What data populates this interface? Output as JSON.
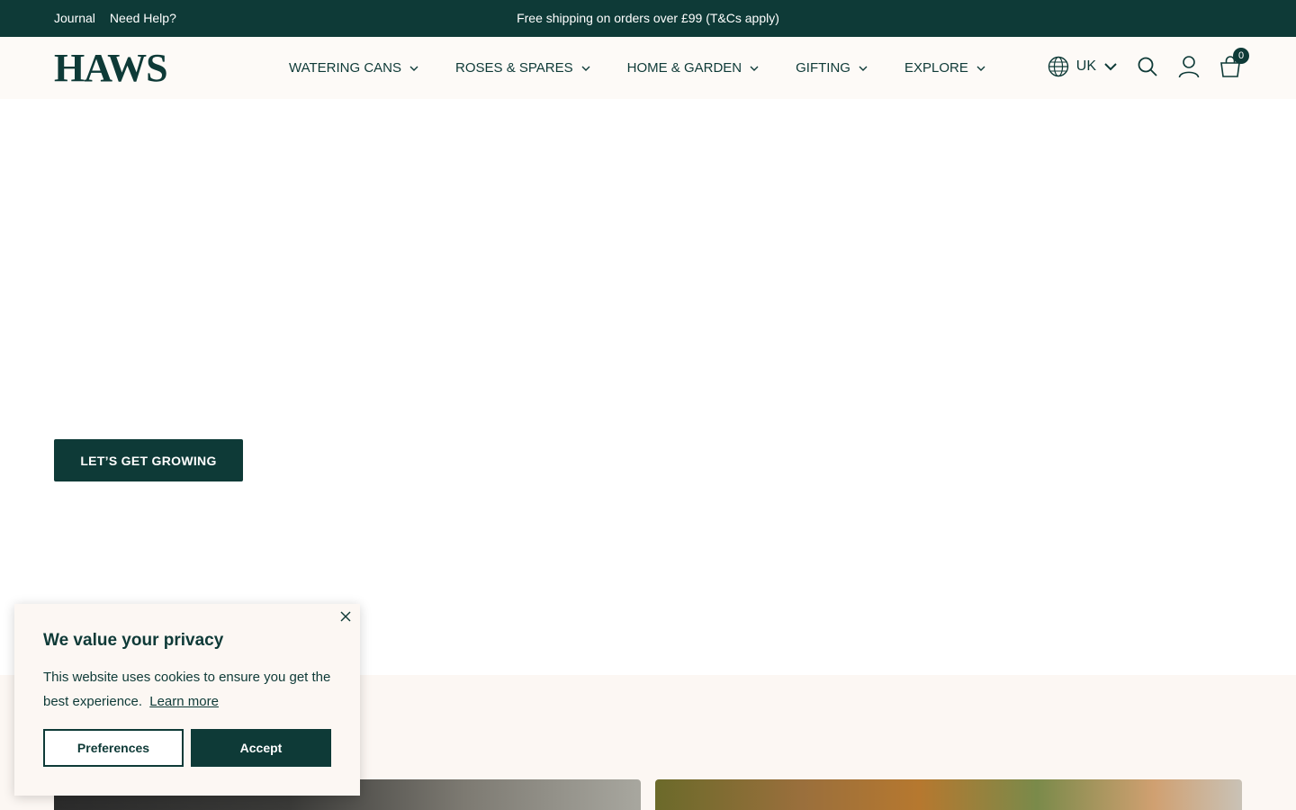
{
  "topbar": {
    "links": [
      "Journal",
      "Need Help?"
    ],
    "message": "Free shipping on orders over £99 (T&Cs apply)"
  },
  "header": {
    "logo": "HAWS",
    "nav": [
      "WATERING CANS",
      "ROSES & SPARES",
      "HOME & GARDEN",
      "GIFTING",
      "EXPLORE"
    ],
    "region": "UK",
    "cart_count": "0",
    "icons": [
      "globe-icon",
      "chevron-down-icon",
      "search-icon",
      "account-icon",
      "cart-icon"
    ]
  },
  "hero": {
    "cta_label": "LET’S GET GROWING"
  },
  "cookie": {
    "title": "We value your privacy",
    "text": "This website uses cookies to ensure you get the best experience.",
    "learn_more": "Learn more",
    "preferences_label": "Preferences",
    "accept_label": "Accept"
  },
  "colors": {
    "brand": "#0e3a37",
    "header_bg": "#fdfaf7",
    "cookie_bg": "#fcf7f3"
  }
}
